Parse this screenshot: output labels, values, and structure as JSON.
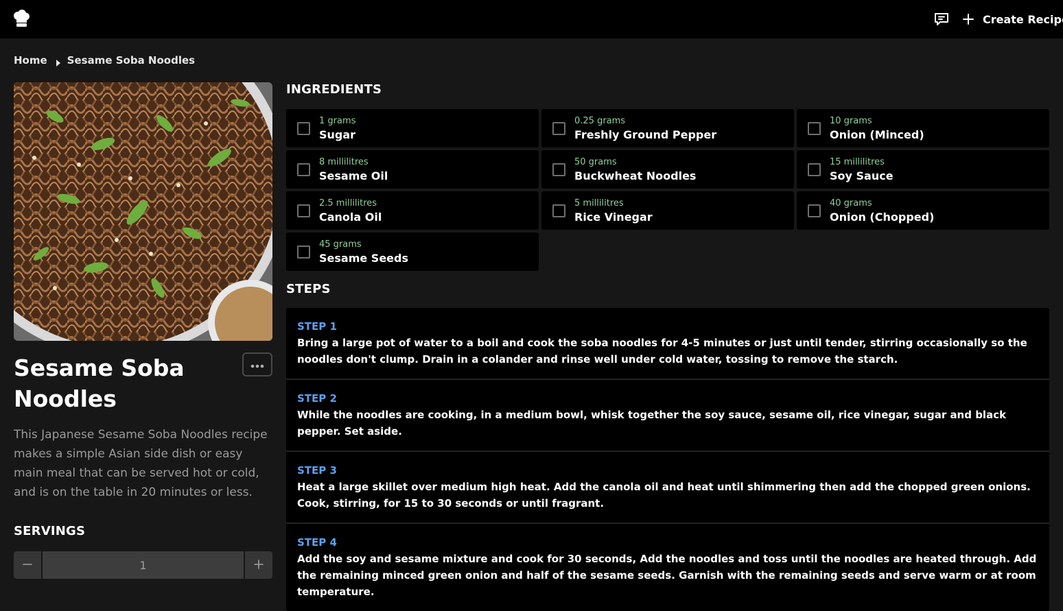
{
  "header": {
    "logo_icon": "chef-hat-icon",
    "feedback_icon": "comment-icon",
    "create_label": "Create Recipe"
  },
  "breadcrumb": {
    "home": "Home",
    "current": "Sesame Soba Noodles"
  },
  "recipe": {
    "title": "Sesame Soba Noodles",
    "description": "This Japanese Sesame Soba Noodles recipe makes a simple Asian side dish or easy main meal that can be served hot or cold, and is on the table in 20 minutes or less.",
    "image": "soba-noodles-photo"
  },
  "servings": {
    "label": "SERVINGS",
    "value": "1",
    "minus": "−",
    "plus": "+"
  },
  "ingredients_title": "INGREDIENTS",
  "ingredients": [
    {
      "qty": "1 grams",
      "name": "Sugar"
    },
    {
      "qty": "0.25 grams",
      "name": "Freshly Ground Pepper"
    },
    {
      "qty": "10 grams",
      "name": "Onion (Minced)"
    },
    {
      "qty": "8 millilitres",
      "name": "Sesame Oil"
    },
    {
      "qty": "50 grams",
      "name": "Buckwheat Noodles"
    },
    {
      "qty": "15 millilitres",
      "name": "Soy Sauce"
    },
    {
      "qty": "2.5 millilitres",
      "name": "Canola Oil"
    },
    {
      "qty": "5 millilitres",
      "name": "Rice Vinegar"
    },
    {
      "qty": "40 grams",
      "name": "Onion (Chopped)"
    },
    {
      "qty": "45 grams",
      "name": "Sesame Seeds"
    }
  ],
  "steps_title": "STEPS",
  "steps": [
    {
      "label": "STEP 1",
      "text": "Bring a large pot of water to a boil and cook the soba noodles for 4-5 minutes or just until tender, stirring occasionally so the noodles don't clump. Drain in a colander and rinse well under cold water, tossing to remove the starch."
    },
    {
      "label": "STEP 2",
      "text": "While the noodles are cooking, in a medium bowl, whisk together the soy sauce, sesame oil, rice vinegar, sugar and black pepper. Set aside."
    },
    {
      "label": "STEP 3",
      "text": "Heat a large skillet over medium high heat. Add the canola oil and heat until shimmering then add the chopped green onions. Cook, stirring, for 15 to 30 seconds or until fragrant."
    },
    {
      "label": "STEP 4",
      "text": "Add the soy and sesame mixture and cook for 30 seconds, Add the noodles and toss until the noodles are heated through. Add the remaining minced green onion and half of the sesame seeds. Garnish with the remaining seeds and serve warm or at room temperature."
    }
  ],
  "colors": {
    "background": "#171717",
    "bar": "#000000",
    "quantity": "#8fd19e",
    "step_label": "#5aa0f2"
  }
}
